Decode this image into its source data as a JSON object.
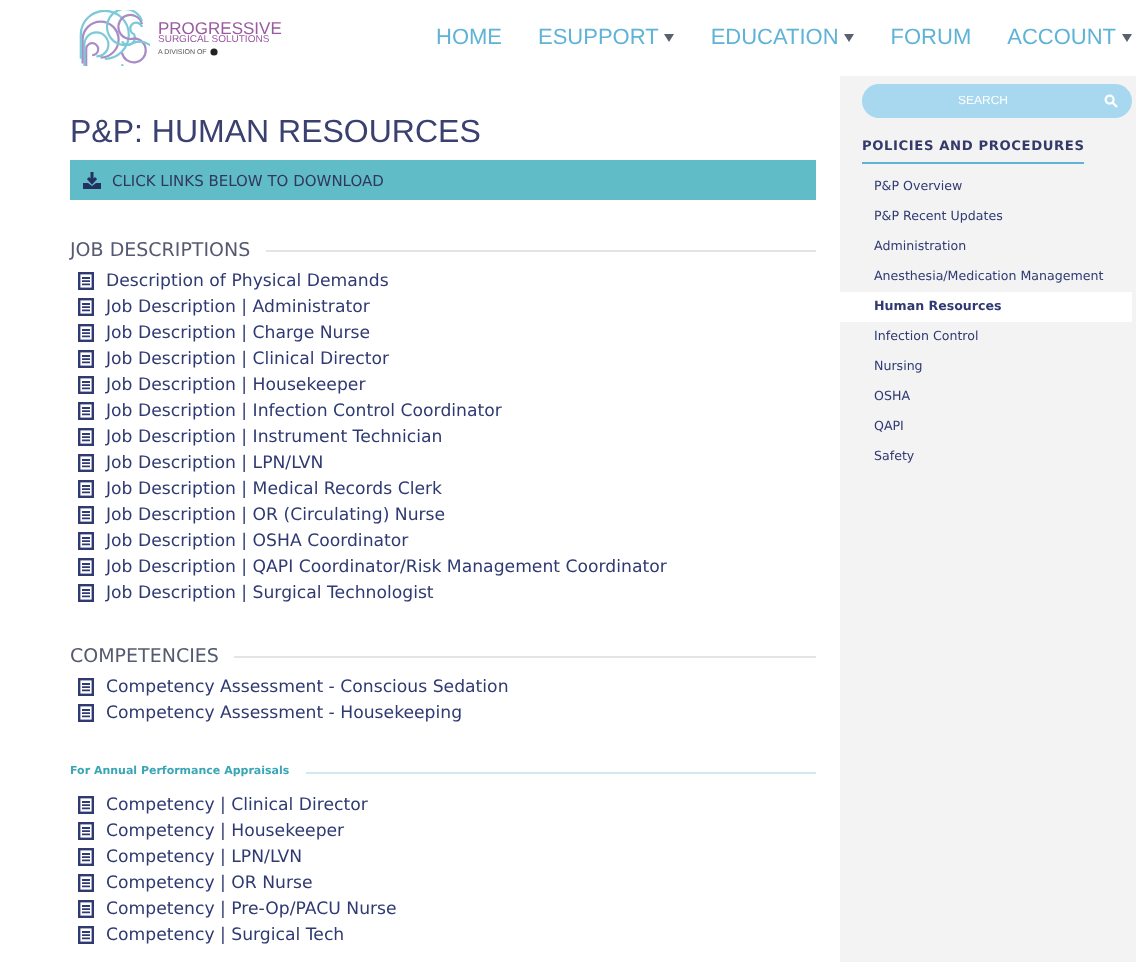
{
  "logo": {
    "name": "PROGRESSIVE",
    "subtitle": "SURGICAL SOLUTIONS",
    "division": "A DIVISION OF"
  },
  "nav": [
    {
      "label": "HOME",
      "dropdown": false
    },
    {
      "label": "ESUPPORT",
      "dropdown": true
    },
    {
      "label": "EDUCATION",
      "dropdown": true
    },
    {
      "label": "FORUM",
      "dropdown": false
    },
    {
      "label": "ACCOUNT",
      "dropdown": true
    }
  ],
  "page_title": "P&P: HUMAN RESOURCES",
  "banner": "CLICK LINKS BELOW TO DOWNLOAD",
  "sections": [
    {
      "kind": "heading",
      "title": "JOB DESCRIPTIONS",
      "items": [
        "Description of Physical Demands",
        "Job Description | Administrator",
        "Job Description | Charge Nurse",
        "Job Description | Clinical Director",
        "Job Description | Housekeeper",
        "Job Description | Infection Control Coordinator",
        "Job Description | Instrument Technician",
        "Job Description | LPN/LVN",
        "Job Description | Medical Records Clerk",
        "Job Description | OR (Circulating) Nurse",
        "Job Description | OSHA Coordinator",
        "Job Description | QAPI Coordinator/Risk Management Coordinator",
        "Job Description | Surgical Technologist"
      ]
    },
    {
      "kind": "heading",
      "title": "COMPETENCIES",
      "items": [
        "Competency Assessment - Conscious Sedation",
        "Competency Assessment - Housekeeping"
      ]
    },
    {
      "kind": "subheading",
      "title": "For Annual Performance Appraisals",
      "items": [
        "Competency | Clinical Director",
        "Competency | Housekeeper",
        "Competency | LPN/LVN",
        "Competency | OR Nurse",
        "Competency | Pre-Op/PACU Nurse",
        "Competency | Surgical Tech"
      ]
    }
  ],
  "sidebar": {
    "search": {
      "placeholder": "SEARCH"
    },
    "heading": "POLICIES AND PROCEDURES",
    "items": [
      {
        "label": "P&P Overview",
        "selected": false
      },
      {
        "label": "P&P Recent Updates",
        "selected": false
      },
      {
        "label": "Administration",
        "selected": false
      },
      {
        "label": "Anesthesia/Medication Management",
        "selected": false
      },
      {
        "label": "Human Resources",
        "selected": true
      },
      {
        "label": "Infection Control",
        "selected": false
      },
      {
        "label": "Nursing",
        "selected": false
      },
      {
        "label": "OSHA",
        "selected": false
      },
      {
        "label": "QAPI",
        "selected": false
      },
      {
        "label": "Safety",
        "selected": false
      }
    ]
  }
}
